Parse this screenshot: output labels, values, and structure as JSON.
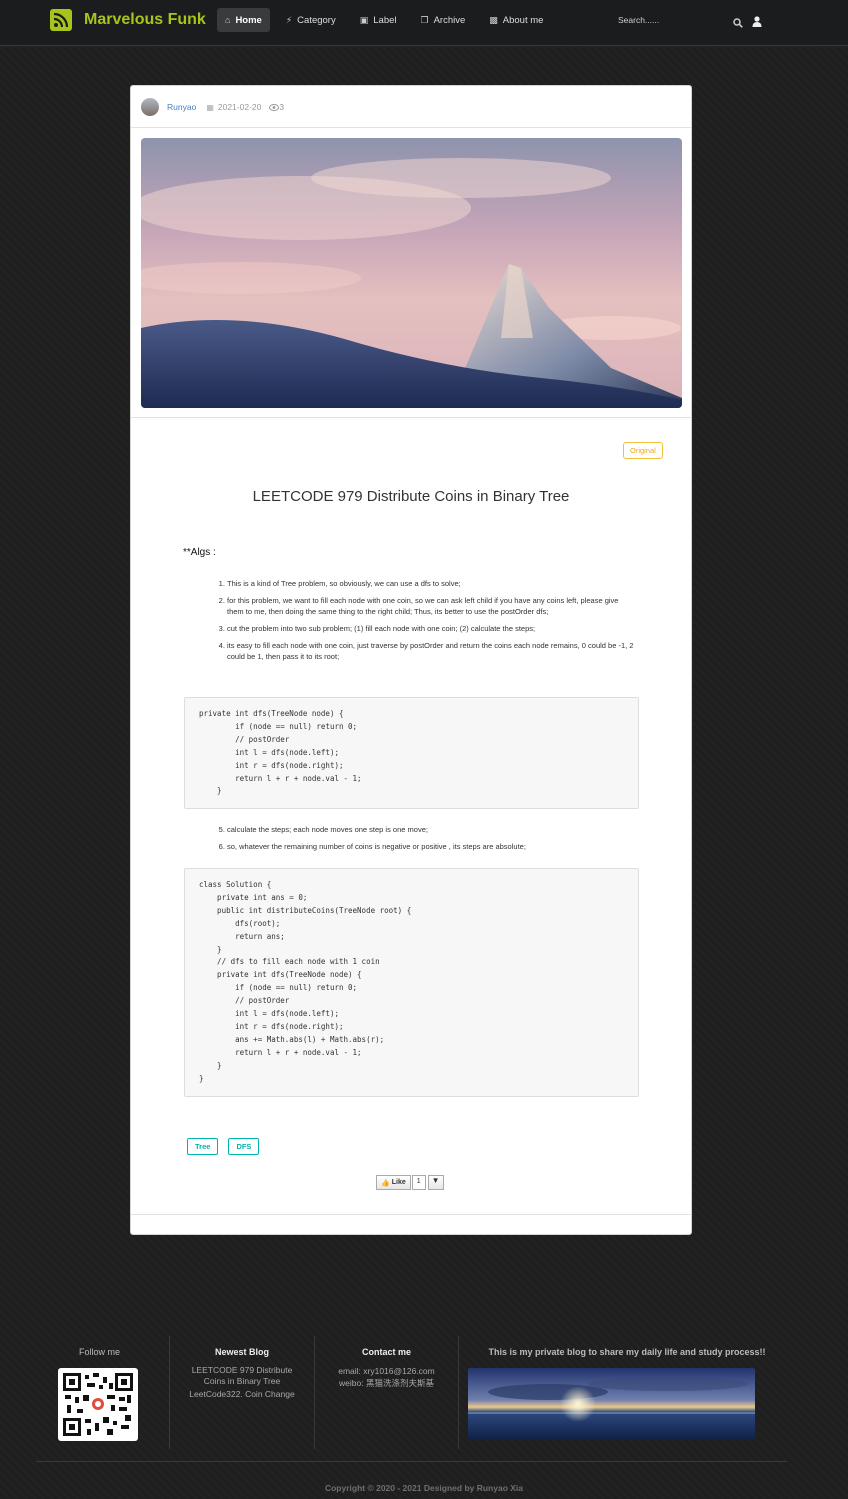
{
  "nav": {
    "brand": "Marvelous Funk",
    "items": [
      {
        "label": "Home",
        "icon": "home-icon",
        "active": true
      },
      {
        "label": "Category",
        "icon": "bolt-icon",
        "active": false
      },
      {
        "label": "Label",
        "icon": "label-icon",
        "active": false
      },
      {
        "label": "Archive",
        "icon": "archive-icon",
        "active": false
      },
      {
        "label": "About me",
        "icon": "contact-icon",
        "active": false
      }
    ],
    "search_placeholder": "Search......",
    "accent": "#a7c41b"
  },
  "post": {
    "author": "Runyao",
    "date": "2021-02-20",
    "views": "3",
    "badge": "Original",
    "title": "LEETCODE 979 Distribute Coins in Binary Tree",
    "algs_label": "**Algs :",
    "steps_a": [
      "This is a kind of Tree problem, so obviously, we can use a dfs to solve;",
      "for this problem, we want to fill each node with one coin, so we can ask left child if you have any coins left, please give them to me, then doing the same thing to the right child; Thus, its better to use the postOrder dfs;",
      "cut the problem into two sub problem; (1) fill each node with one coin; (2) calculate the steps;",
      "its easy to fill each node with one coin, just traverse by postOrder and return the coins each node remains, 0 could be -1, 2 could be 1, then pass it to its root;"
    ],
    "code1": "private int dfs(TreeNode node) {\n        if (node == null) return 0;\n        // postOrder\n        int l = dfs(node.left);\n        int r = dfs(node.right);\n        return l + r + node.val - 1;\n    }",
    "steps_b": [
      "calculate the steps; each node moves one step is one move;",
      "so, whatever the remaining number of coins is negative or positive , its steps are absolute;"
    ],
    "code2": "class Solution {\n    private int ans = 0;\n    public int distributeCoins(TreeNode root) {\n        dfs(root);\n        return ans;\n    }\n    // dfs to fill each node with 1 coin\n    private int dfs(TreeNode node) {\n        if (node == null) return 0;\n        // postOrder\n        int l = dfs(node.left);\n        int r = dfs(node.right);\n        ans += Math.abs(l) + Math.abs(r);\n        return l + r + node.val - 1;\n    }\n}",
    "tags": [
      "Tree",
      "DFS"
    ],
    "like_label": "Like",
    "like_count": "1"
  },
  "footer": {
    "follow_title": "Follow me",
    "newest_title": "Newest Blog",
    "newest_items": [
      "LEETCODE 979 Distribute Coins in Binary Tree",
      "LeetCode322. Coin Change"
    ],
    "contact_title": "Contact me",
    "email": "email: xry1016@126.com",
    "weibo": "weibo: 黑猫洗涤剂夫斯基",
    "about_text": "This is my private blog to share my daily life and study process!!",
    "copyright": "Copyright © 2020 - 2021 Designed by Runyao Xia"
  }
}
